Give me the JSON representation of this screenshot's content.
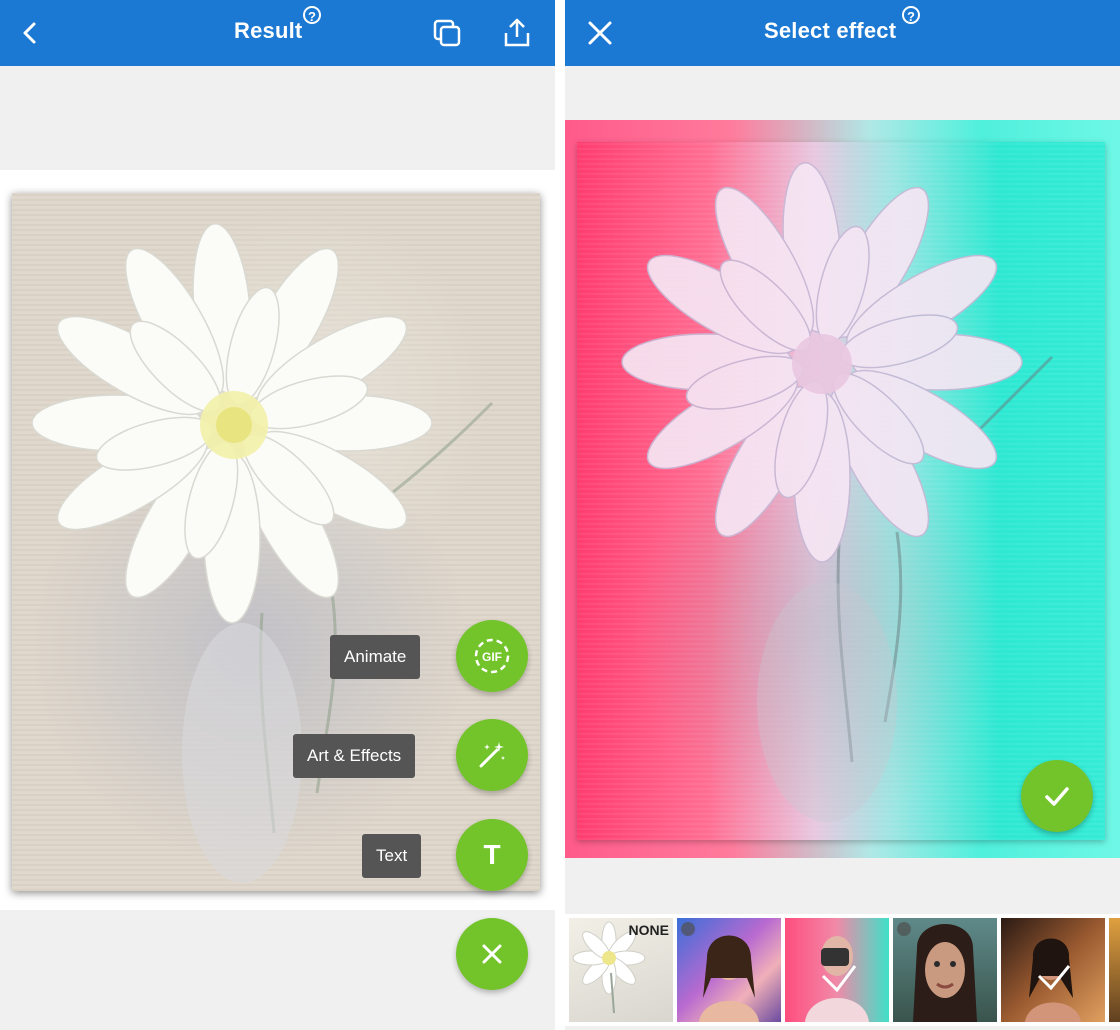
{
  "left_screen": {
    "title": "Result",
    "help_label": "?",
    "actions": [
      {
        "label": "Animate",
        "icon": "gif-icon",
        "icon_text": "GIF"
      },
      {
        "label": "Art & Effects",
        "icon": "magic-wand-icon"
      },
      {
        "label": "Text",
        "icon": "text-icon",
        "icon_text": "T"
      }
    ],
    "close_fab_icon": "close-icon"
  },
  "right_screen": {
    "title": "Select effect",
    "help_label": "?",
    "confirm_icon": "checkmark-icon",
    "effects": [
      {
        "label": "NONE",
        "kind": "original"
      },
      {
        "label": "",
        "kind": "portrait-effect"
      },
      {
        "label": "",
        "kind": "portrait-effect"
      },
      {
        "label": "",
        "kind": "portrait-effect"
      },
      {
        "label": "",
        "kind": "portrait-effect"
      }
    ]
  },
  "colors": {
    "toolbar_blue": "#1b79d3",
    "fab_green": "#72c42a",
    "tooltip_gray": "#555555"
  }
}
